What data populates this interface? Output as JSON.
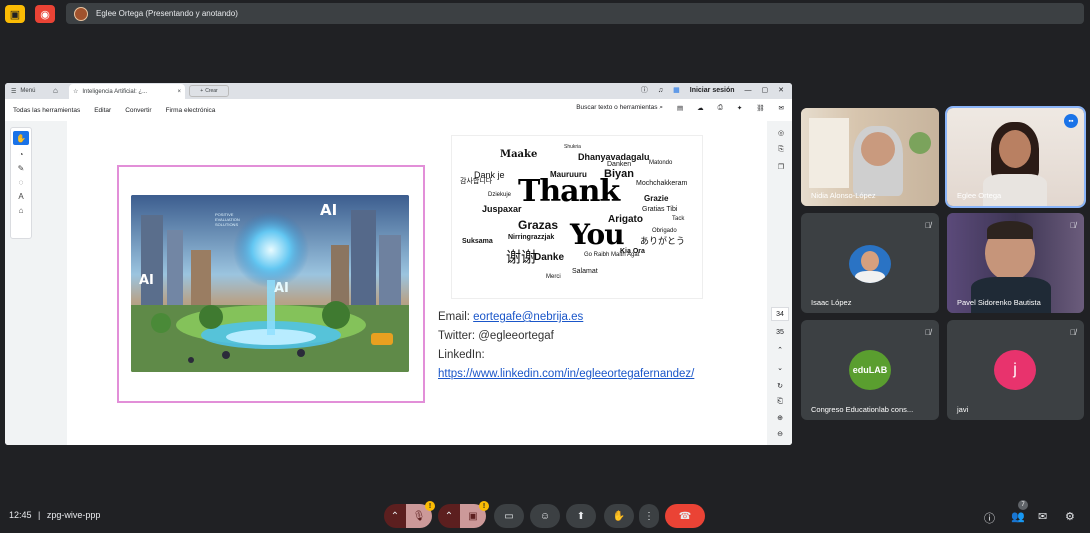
{
  "meet": {
    "presenter_label": "Eglee Ortega (Presentando y anotando)",
    "time": "12:45",
    "separator": "|",
    "meeting_code": "zpg-wive-ppp",
    "participant_count": "7"
  },
  "browser": {
    "menu_label": "Menú",
    "tab_title": "Inteligencia Artificial: ¿...",
    "tab_close": "×",
    "new_tab_label": "Crear",
    "login_label": "Iniciar sesión"
  },
  "pdf_toolbar": {
    "items": [
      "Todas las herramientas",
      "Editar",
      "Convertir",
      "Firma electrónica"
    ],
    "search_label": "Buscar texto o herramientas"
  },
  "slide": {
    "ai_badge_1": "AI",
    "ai_badge_2": "AI",
    "ai_badge_3": "AI",
    "ai_sign_text": "POSITIVE EVALUATION SOLUTIONS",
    "thank_you_line1": "Thank",
    "thank_you_line2": "You",
    "cloud_words": [
      "Maake",
      "Shukria",
      "Dhanyavadagalu",
      "Mauruuru",
      "Biyan",
      "Danken",
      "Matondo",
      "Dank je",
      "Arigato",
      "Grazas",
      "Juspaxar",
      "Grazie",
      "Gratias Tibi",
      "Merci",
      "Danke",
      "Go Raibh Maith Agat",
      "Salamat",
      "Obrigado",
      "Kia Ora",
      "Mochchakkeram",
      "ありがとう",
      "谢谢",
      "감사합니다",
      "Tack",
      "Suksama",
      "Dziekuje",
      "Nirringrazzjak"
    ],
    "email_label": "Email: ",
    "email_value": "eortegafe@nebrija.es",
    "twitter_line": "Twitter: @egleeortegaf",
    "linkedin_label": "LinkedIn:",
    "linkedin_url": "https://www.linkedin.com/in/egleeortegafernandez/",
    "page_current": "34",
    "page_next": "35"
  },
  "participants": [
    {
      "name": "Nidia Alonso-López"
    },
    {
      "name": "Eglee Ortega"
    },
    {
      "name": "Isaac López"
    },
    {
      "name": "Pavel Sidorenko Bautista"
    },
    {
      "name": "Congreso Educationlab cons...",
      "avatar_text": "eduLAB"
    },
    {
      "name": "javi",
      "avatar_text": "j"
    }
  ],
  "colors": {
    "end_call": "#ea4335",
    "muted_button": "#8c2b2b",
    "javi_avatar": "#e8336d",
    "edulab_avatar": "#5a9e2f",
    "warning": "#fbbc04"
  }
}
